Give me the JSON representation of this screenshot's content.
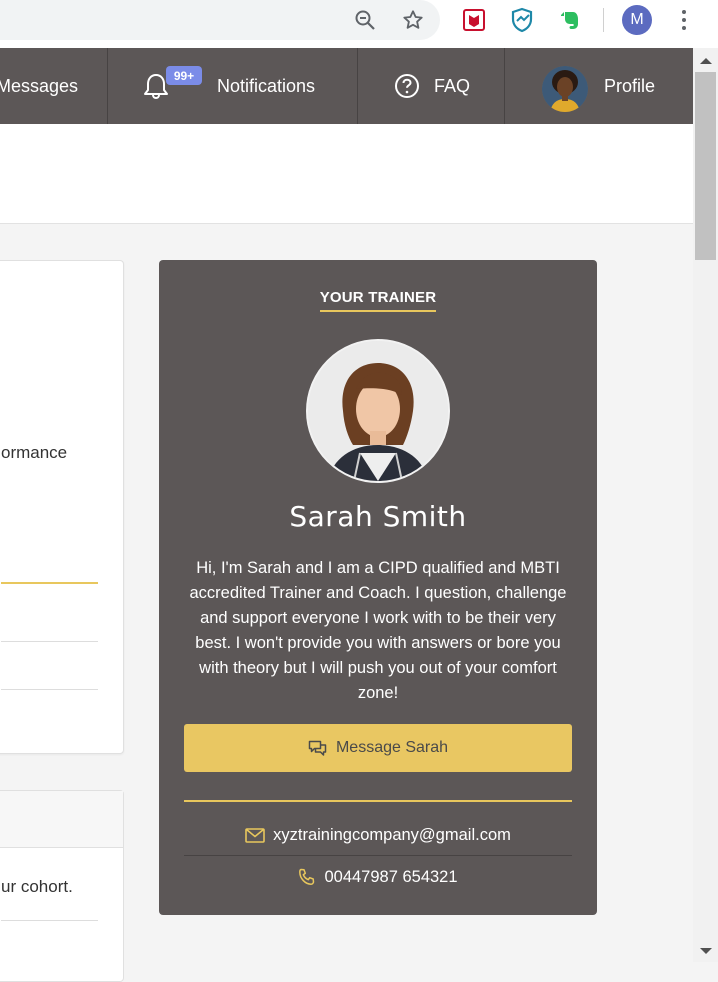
{
  "browser": {
    "extensions": [
      "zoom-out-icon",
      "star-icon",
      "mcafee-icon",
      "shield-extension-icon",
      "evernote-icon"
    ],
    "profile_initial": "M"
  },
  "nav": {
    "messages_label": "Messages",
    "notifications_label": "Notifications",
    "notifications_badge": "99+",
    "faq_label": "FAQ",
    "profile_label": "Profile"
  },
  "left": {
    "card1_fragment": "ormance",
    "card2_fragment": "ur cohort."
  },
  "trainer": {
    "heading": "YOUR TRAINER",
    "name": "Sarah Smith",
    "bio": "Hi, I'm Sarah and I am a CIPD qualified and MBTI accredited Trainer and Coach. I question, challenge and support everyone I work with to be their very best. I won't provide you with answers or bore you with theory but I will push you out of your comfort zone!",
    "message_button": "Message Sarah",
    "email": "xyztrainingcompany@gmail.com",
    "phone": "00447987 654321"
  },
  "colors": {
    "nav_bg": "#5c5757",
    "accent": "#e8c75d",
    "badge": "#7b8ce8"
  }
}
